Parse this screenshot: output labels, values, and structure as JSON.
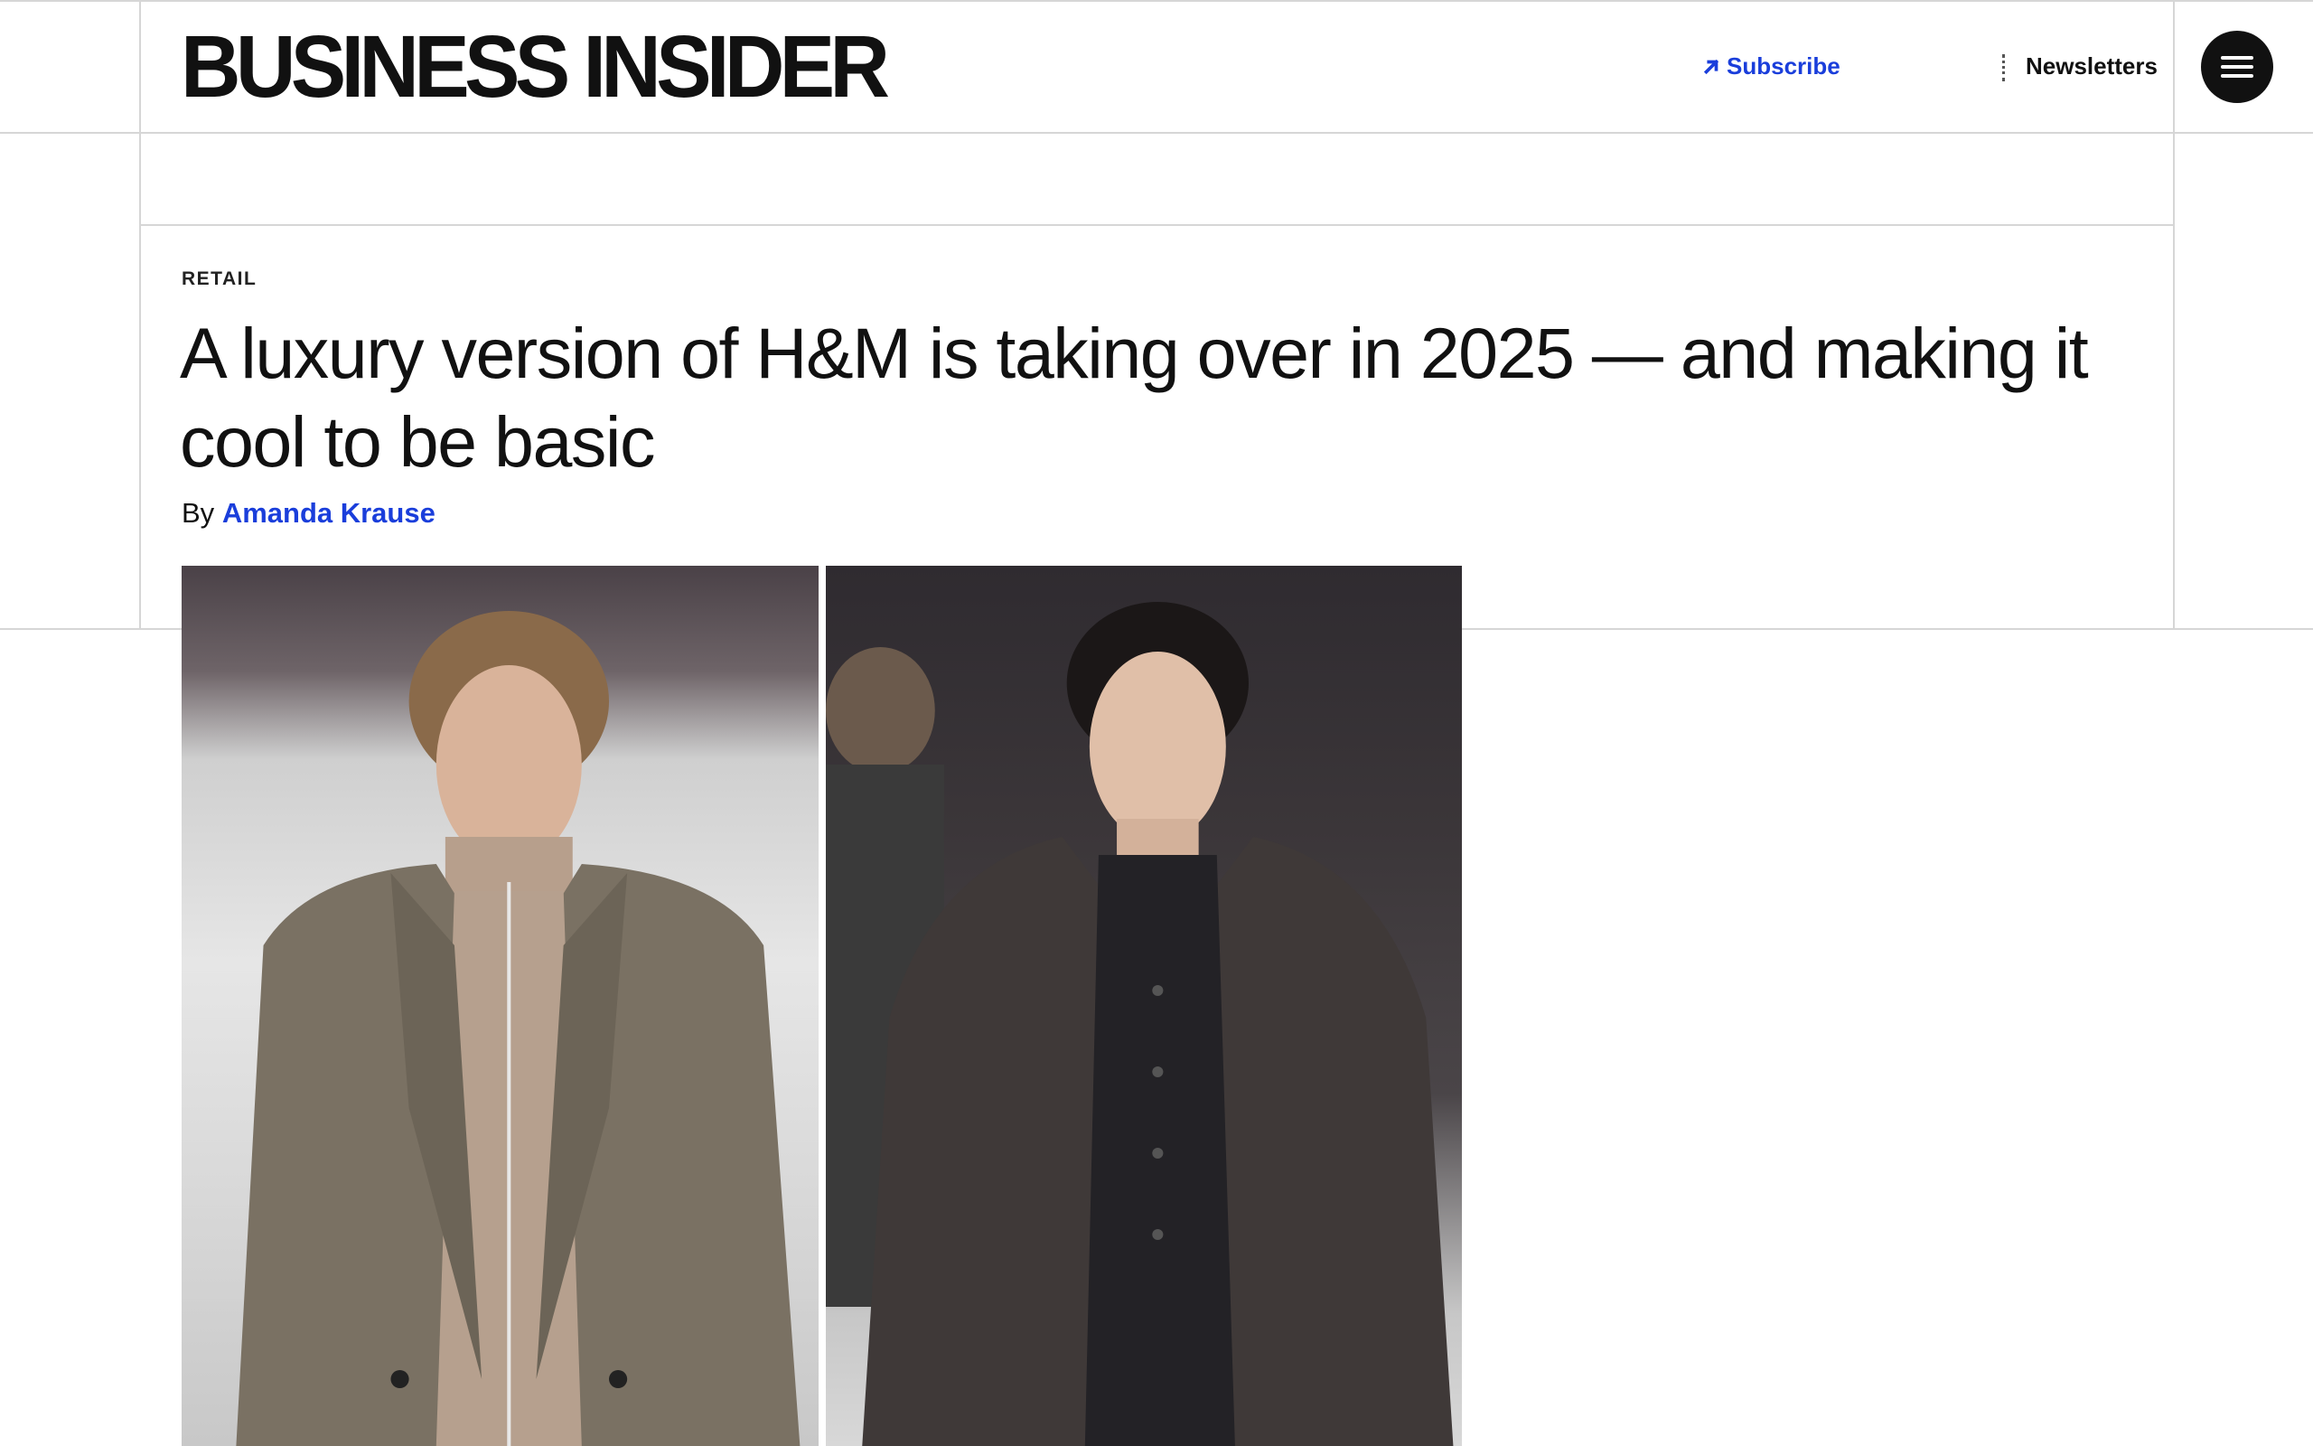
{
  "header": {
    "logo": "BUSINESS INSIDER",
    "subscribe_label": "Subscribe",
    "newsletters_label": "Newsletters",
    "menu_icon": "hamburger-icon",
    "subscribe_icon": "arrow-up-right-icon"
  },
  "article": {
    "category": "RETAIL",
    "headline": "A luxury version of H&M is taking over in 2025 — and making it cool to be basic",
    "byline_prefix": "By",
    "author": "Amanda Krause"
  },
  "colors": {
    "accent": "#1a3edb",
    "text": "#111111",
    "grid_lines": "#d6d6d6"
  }
}
